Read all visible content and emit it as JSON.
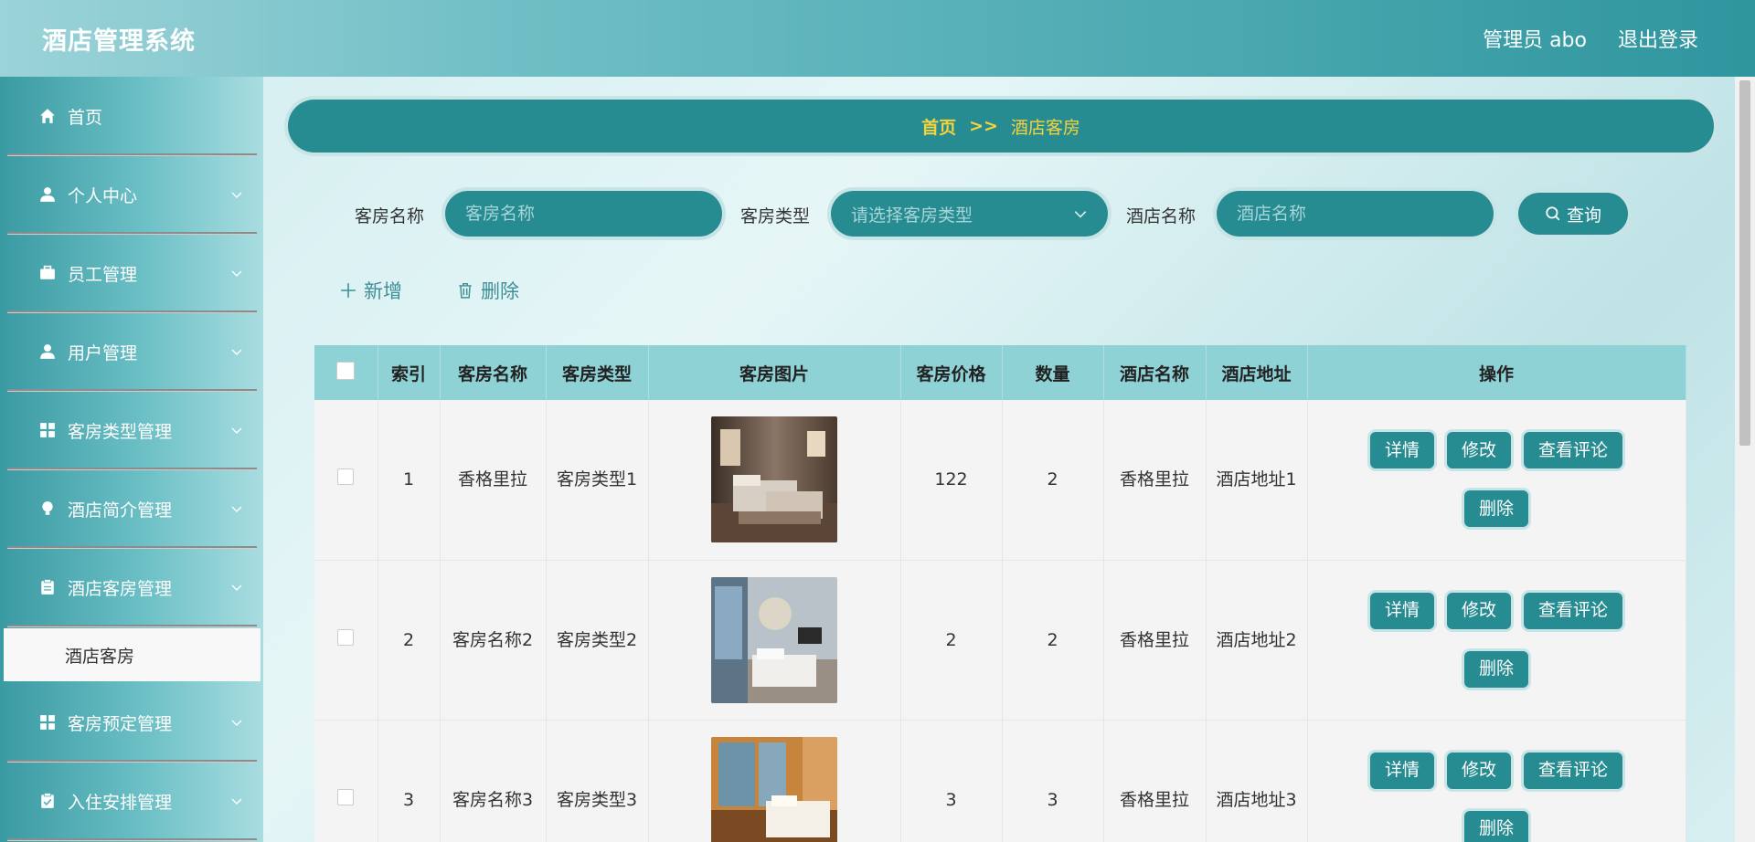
{
  "header": {
    "title": "酒店管理系统",
    "user_label": "管理员 abo",
    "logout_label": "退出登录"
  },
  "sidebar": {
    "items": [
      {
        "label": "首页",
        "icon": "home-icon"
      },
      {
        "label": "个人中心",
        "icon": "user-icon"
      },
      {
        "label": "员工管理",
        "icon": "briefcase-icon"
      },
      {
        "label": "用户管理",
        "icon": "user-icon"
      },
      {
        "label": "客房类型管理",
        "icon": "grid-icon"
      },
      {
        "label": "酒店简介管理",
        "icon": "bulb-icon"
      },
      {
        "label": "酒店客房管理",
        "icon": "clipboard-icon"
      },
      {
        "label": "客房预定管理",
        "icon": "grid-icon"
      },
      {
        "label": "入住安排管理",
        "icon": "clipboard-check-icon"
      }
    ],
    "active_sub": "酒店客房"
  },
  "breadcrumb": {
    "home": "首页",
    "separator": ">>",
    "current": "酒店客房"
  },
  "search": {
    "room_name_label": "客房名称",
    "room_name_placeholder": "客房名称",
    "room_type_label": "客房类型",
    "room_type_placeholder": "请选择客房类型",
    "hotel_name_label": "酒店名称",
    "hotel_name_placeholder": "酒店名称",
    "query_label": "查询"
  },
  "actions": {
    "add_label": "新增",
    "delete_label": "删除"
  },
  "table": {
    "headers": [
      "索引",
      "客房名称",
      "客房类型",
      "客房图片",
      "客房价格",
      "数量",
      "酒店名称",
      "酒店地址",
      "操作"
    ],
    "ops": {
      "detail": "详情",
      "edit": "修改",
      "reviews": "查看评论",
      "delete": "删除"
    },
    "rows": [
      {
        "index": "1",
        "room_name": "香格里拉",
        "room_type": "客房类型1",
        "price": "122",
        "qty": "2",
        "hotel": "香格里拉",
        "address": "酒店地址1"
      },
      {
        "index": "2",
        "room_name": "客房名称2",
        "room_type": "客房类型2",
        "price": "2",
        "qty": "2",
        "hotel": "香格里拉",
        "address": "酒店地址2"
      },
      {
        "index": "3",
        "room_name": "客房名称3",
        "room_type": "客房类型3",
        "price": "3",
        "qty": "3",
        "hotel": "香格里拉",
        "address": "酒店地址3"
      }
    ]
  },
  "colors": {
    "primary": "#268c92",
    "accent": "#f5d33b",
    "header_bg": "#8fd2d6"
  }
}
